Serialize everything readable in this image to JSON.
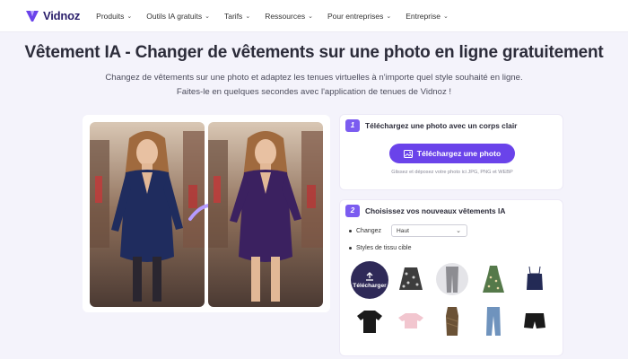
{
  "nav": {
    "logo_text": "Vidnoz",
    "items": [
      {
        "label": "Produits"
      },
      {
        "label": "Outils IA gratuits"
      },
      {
        "label": "Tarifs"
      },
      {
        "label": "Ressources"
      },
      {
        "label": "Pour entreprises"
      },
      {
        "label": "Entreprise"
      }
    ]
  },
  "hero": {
    "title": "Vêtement IA - Changer de vêtements sur une photo en ligne gratuitement",
    "subtitle_line1": "Changez de vêtements sur une photo et adaptez les tenues virtuelles à n'importe quel style souhaité en ligne.",
    "subtitle_line2": "Faites-le en quelques secondes avec l'application de tenues de Vidnoz !"
  },
  "step1": {
    "number": "1",
    "title": "Téléchargez une photo avec un corps clair",
    "button": "Téléchargez une photo",
    "hint": "Glissez et déposez votre photo ici JPG, PNG et WEBP"
  },
  "step2": {
    "number": "2",
    "title": "Choisissez vos nouveaux vêtements IA",
    "change_label": "Changez",
    "change_value": "Haut",
    "styles_label": "Styles de tissu cible",
    "upload_tile_label": "Télécharger"
  },
  "colors": {
    "accent": "#6a43ea",
    "badge": "#7b5cf0",
    "dress_left": "#1f2c5e",
    "dress_right": "#3b2160"
  },
  "icons": [
    "chevron-down-icon",
    "image-icon",
    "upload-icon",
    "arrow-right-icon"
  ],
  "garments": [
    {
      "name": "floral-skirt"
    },
    {
      "name": "grey-trousers"
    },
    {
      "name": "green-floral-dress"
    },
    {
      "name": "navy-camisole"
    },
    {
      "name": "black-tshirt"
    },
    {
      "name": "pink-crop-top"
    },
    {
      "name": "brown-bodycon-dress"
    },
    {
      "name": "blue-jeans"
    },
    {
      "name": "black-shorts"
    }
  ]
}
